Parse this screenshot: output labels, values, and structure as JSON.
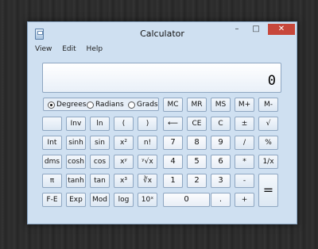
{
  "window": {
    "title": "Calculator"
  },
  "titlebar": {
    "min": "–",
    "max": "□",
    "close": "✕"
  },
  "menu": [
    "View",
    "Edit",
    "Help"
  ],
  "display": {
    "value": "0"
  },
  "angle_modes": [
    {
      "label": "Degrees",
      "selected": true
    },
    {
      "label": "Radians",
      "selected": false
    },
    {
      "label": "Grads",
      "selected": false
    }
  ],
  "memory": [
    "MC",
    "MR",
    "MS",
    "M+",
    "M-"
  ],
  "rows": [
    [
      "",
      "Inv",
      "ln",
      "(",
      ")",
      "⟵",
      "CE",
      "C",
      "±",
      "√"
    ],
    [
      "Int",
      "sinh",
      "sin",
      "x²",
      "n!",
      "7",
      "8",
      "9",
      "/",
      "%"
    ],
    [
      "dms",
      "cosh",
      "cos",
      "xʸ",
      "ʸ√x",
      "4",
      "5",
      "6",
      "*",
      "1/x"
    ],
    [
      "π",
      "tanh",
      "tan",
      "x³",
      "∛x",
      "1",
      "2",
      "3",
      "-",
      "="
    ],
    [
      "F-E",
      "Exp",
      "Mod",
      "log",
      "10ˣ",
      "0",
      "",
      ".",
      "+",
      ""
    ]
  ]
}
